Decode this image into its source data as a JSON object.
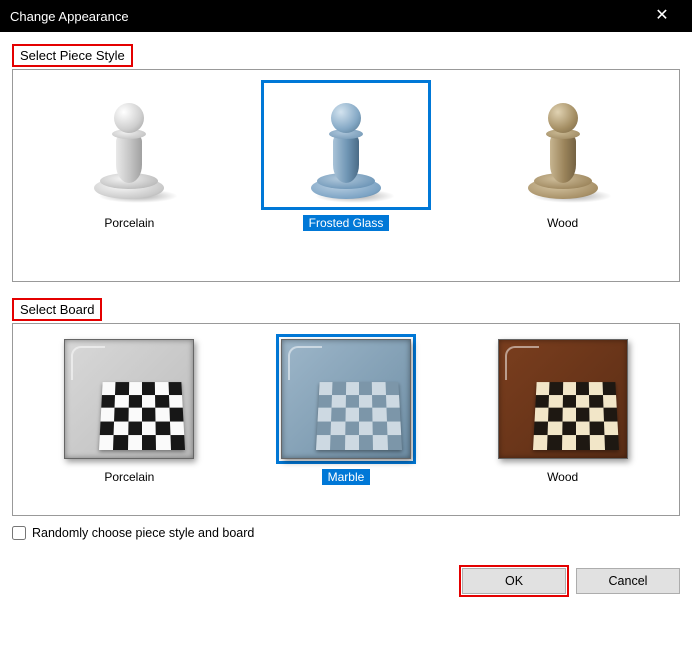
{
  "window": {
    "title": "Change Appearance"
  },
  "sections": {
    "piece_style": {
      "label": "Select Piece Style",
      "options": [
        {
          "label": "Porcelain"
        },
        {
          "label": "Frosted Glass"
        },
        {
          "label": "Wood"
        }
      ],
      "selected_index": 1
    },
    "board": {
      "label": "Select Board",
      "options": [
        {
          "label": "Porcelain"
        },
        {
          "label": "Marble"
        },
        {
          "label": "Wood"
        }
      ],
      "selected_index": 1
    }
  },
  "checkbox": {
    "label": "Randomly choose piece style and board",
    "checked": false
  },
  "buttons": {
    "ok": "OK",
    "cancel": "Cancel"
  }
}
